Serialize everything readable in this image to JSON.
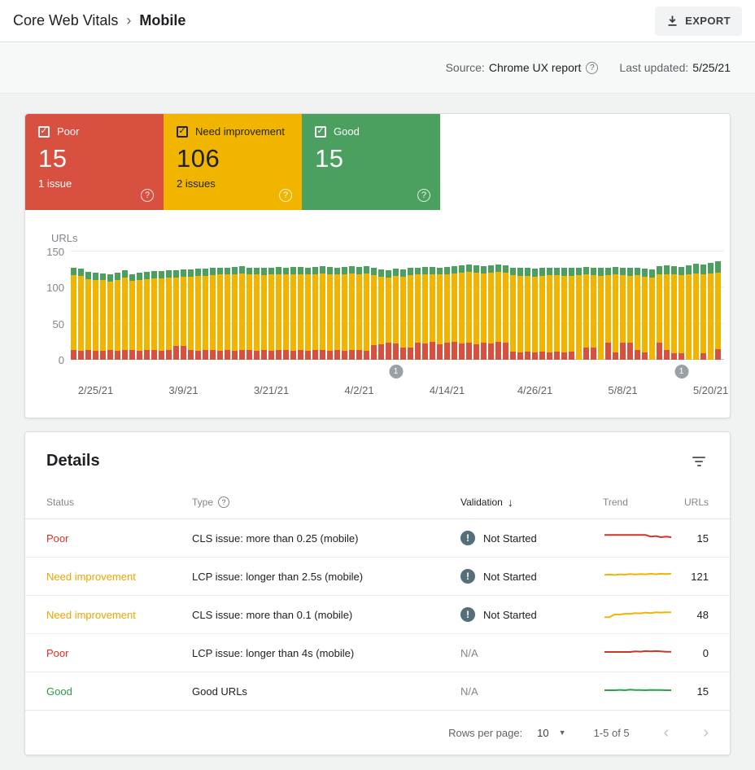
{
  "icons": {
    "breadcrumb_sep": "›",
    "help": "?",
    "check": "✓",
    "sort_desc": "↓",
    "dropdown": "▼",
    "prev": "‹",
    "next": "›",
    "exclamation": "!"
  },
  "header": {
    "breadcrumb_root": "Core Web Vitals",
    "breadcrumb_current": "Mobile",
    "export_label": "EXPORT"
  },
  "meta": {
    "source_label": "Source:",
    "source_value": "Chrome UX report",
    "updated_label": "Last updated:",
    "updated_value": "5/25/21"
  },
  "cards": [
    {
      "id": "poor",
      "label": "Poor",
      "value": "15",
      "sub": "1 issue",
      "bg": "#d8503f",
      "text": "#ffffff"
    },
    {
      "id": "need-improvement",
      "label": "Need improvement",
      "value": "106",
      "sub": "2 issues",
      "bg": "#f1b500",
      "text": "#202124"
    },
    {
      "id": "good",
      "label": "Good",
      "value": "15",
      "sub": "",
      "bg": "#4ba05f",
      "text": "#ffffff"
    }
  ],
  "chart_data": {
    "type": "bar",
    "stacked": true,
    "ylabel": "URLs",
    "ylim": [
      0,
      150
    ],
    "yticks": [
      0,
      50,
      100,
      150
    ],
    "x_tick_labels": [
      {
        "index": 3,
        "label": "2/25/21"
      },
      {
        "index": 15,
        "label": "3/9/21"
      },
      {
        "index": 27,
        "label": "3/21/21"
      },
      {
        "index": 39,
        "label": "4/2/21"
      },
      {
        "index": 51,
        "label": "4/14/21"
      },
      {
        "index": 63,
        "label": "4/26/21"
      },
      {
        "index": 75,
        "label": "5/8/21"
      },
      {
        "index": 87,
        "label": "5/20/21"
      }
    ],
    "annotations": [
      {
        "index": 44,
        "label": "1"
      },
      {
        "index": 83,
        "label": "1"
      }
    ],
    "series": [
      {
        "name": "Poor",
        "color": "#d8503f",
        "values": [
          13,
          12,
          13,
          12,
          12,
          13,
          12,
          13,
          13,
          12,
          13,
          13,
          12,
          13,
          19,
          19,
          13,
          12,
          13,
          13,
          12,
          13,
          12,
          13,
          13,
          12,
          13,
          12,
          13,
          13,
          12,
          13,
          12,
          13,
          13,
          12,
          13,
          12,
          13,
          13,
          12,
          20,
          22,
          24,
          23,
          17,
          17,
          24,
          23,
          25,
          22,
          24,
          25,
          23,
          24,
          22,
          24,
          23,
          25,
          24,
          11,
          10,
          11,
          10,
          11,
          10,
          11,
          10,
          11,
          0,
          17,
          17,
          0,
          24,
          10,
          24,
          24,
          14,
          10,
          0,
          24,
          13,
          9,
          9,
          0,
          0,
          9,
          0,
          15
        ]
      },
      {
        "name": "Need improvement",
        "color": "#f1b500",
        "values": [
          104,
          104,
          99,
          99,
          98,
          95,
          99,
          101,
          96,
          99,
          99,
          100,
          101,
          101,
          95,
          96,
          102,
          104,
          103,
          104,
          106,
          105,
          107,
          107,
          105,
          106,
          104,
          106,
          106,
          105,
          107,
          106,
          106,
          106,
          107,
          107,
          105,
          107,
          107,
          106,
          108,
          97,
          93,
          90,
          93,
          98,
          100,
          94,
          96,
          94,
          96,
          95,
          95,
          98,
          98,
          99,
          96,
          98,
          97,
          97,
          106,
          106,
          105,
          105,
          105,
          107,
          106,
          106,
          105,
          117,
          101,
          100,
          116,
          93,
          108,
          93,
          92,
          103,
          105,
          114,
          94,
          106,
          109,
          108,
          119,
          120,
          110,
          120,
          106
        ]
      },
      {
        "name": "Good",
        "color": "#4ba05f",
        "values": [
          10,
          10,
          10,
          10,
          10,
          10,
          10,
          10,
          10,
          10,
          10,
          10,
          10,
          10,
          10,
          10,
          10,
          10,
          10,
          10,
          10,
          10,
          10,
          10,
          10,
          10,
          10,
          10,
          10,
          10,
          10,
          10,
          10,
          10,
          10,
          10,
          10,
          10,
          10,
          10,
          10,
          10,
          10,
          10,
          10,
          10,
          10,
          10,
          10,
          10,
          10,
          10,
          10,
          10,
          10,
          10,
          10,
          10,
          10,
          10,
          11,
          11,
          11,
          11,
          11,
          11,
          11,
          11,
          11,
          11,
          11,
          11,
          11,
          11,
          11,
          11,
          11,
          11,
          11,
          11,
          12,
          12,
          12,
          12,
          12,
          13,
          13,
          14,
          15
        ]
      }
    ]
  },
  "details": {
    "title": "Details",
    "columns": [
      "Status",
      "Type",
      "Validation",
      "Trend",
      "URLs"
    ],
    "rows": [
      {
        "status": "Poor",
        "status_color": "#d93025",
        "type": "CLS issue: more than 0.25 (mobile)",
        "validation": "Not Started",
        "validation_icon": true,
        "urls": "15",
        "trend": {
          "color": "#c53929",
          "values": [
            7,
            7,
            7,
            7,
            7,
            7,
            7,
            7,
            7,
            5.5,
            6,
            5,
            5.5,
            5
          ]
        }
      },
      {
        "status": "Need improvement",
        "status_color": "#e8a600",
        "type": "LCP issue: longer than 2.5s (mobile)",
        "validation": "Not Started",
        "validation_icon": true,
        "urls": "121",
        "trend": {
          "color": "#f1b500",
          "values": [
            5.5,
            5.8,
            5.4,
            6,
            5.7,
            6.2,
            5.9,
            6.3,
            6,
            6.5,
            6.1,
            6.5,
            6.3,
            6.6
          ]
        }
      },
      {
        "status": "Need improvement",
        "status_color": "#e8a600",
        "type": "CLS issue: more than 0.1 (mobile)",
        "validation": "Not Started",
        "validation_icon": true,
        "urls": "48",
        "trend": {
          "color": "#f1b500",
          "values": [
            2,
            2,
            4.5,
            4.3,
            5,
            4.8,
            5.5,
            5.3,
            6,
            5.6,
            6.2,
            6,
            6.3,
            6.2
          ]
        }
      },
      {
        "status": "Poor",
        "status_color": "#d93025",
        "type": "LCP issue: longer than 4s (mobile)",
        "validation": "N/A",
        "validation_icon": false,
        "urls": "0",
        "trend": {
          "color": "#c53929",
          "values": [
            5,
            5,
            5,
            5,
            5,
            5,
            5.5,
            5.3,
            5.8,
            5.5,
            5.8,
            5.5,
            5.2,
            5.2
          ]
        }
      },
      {
        "status": "Good",
        "status_color": "#2c9a47",
        "type": "Good URLs",
        "validation": "N/A",
        "validation_icon": false,
        "urls": "15",
        "trend": {
          "color": "#2e9e4f",
          "values": [
            5,
            5,
            5,
            5.3,
            5,
            5.5,
            5.2,
            5.2,
            5,
            5.3,
            5.2,
            5.2,
            5,
            5
          ]
        }
      }
    ],
    "pagination": {
      "rows_per_page_label": "Rows per page:",
      "rows_per_page_value": "10",
      "range": "1-5 of 5"
    }
  }
}
